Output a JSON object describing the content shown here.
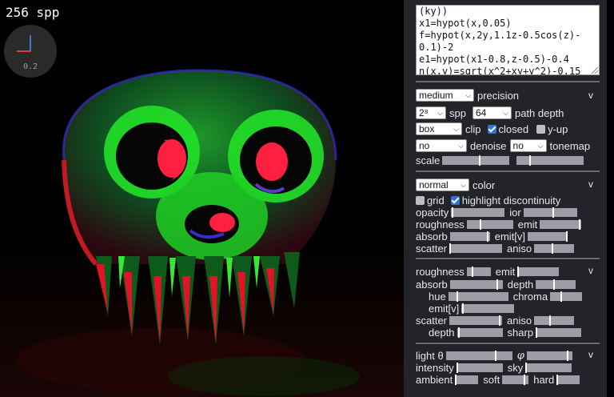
{
  "viewport": {
    "spp_readout": "256 spp",
    "axis_scale": "0.2"
  },
  "editor": {
    "lines": [
      "(ky))",
      "x1=hypot(x,0.05)",
      "f=hypot(x,2y,1.1z-0.5cos(z)-",
      "0.1)-2",
      "e1=hypot(x1-0.8,z-0.5)-0.4",
      "n(x,y)=sqrt(x^2+xy+y^2)-0.15"
    ]
  },
  "render": {
    "precision_value": "medium",
    "precision_label": "precision",
    "spp_value": "2⁸",
    "spp_label": "spp",
    "path_depth_value": "64",
    "path_depth_label": "path depth",
    "clip_value": "box",
    "clip_label": "clip",
    "closed_label": "closed",
    "closed_checked": true,
    "yup_label": "y-up",
    "yup_checked": false,
    "denoise_value": "no",
    "denoise_label": "denoise",
    "tonemap_value": "no",
    "tonemap_label": "tonemap",
    "scale_label": "scale",
    "scale_1": 0.55,
    "scale_2": 0.2,
    "collapse_icon": "v"
  },
  "material": {
    "mode_value": "normal",
    "mode_label": "color",
    "grid_label": "grid",
    "grid_checked": false,
    "highlight_label": "highlight discontinuity",
    "highlight_checked": true,
    "opacity_label": "opacity",
    "opacity": 0.02,
    "ior_label": "ior",
    "ior": 0.55,
    "roughness_label": "roughness",
    "roughness": 0.3,
    "emit_label": "emit",
    "emit": 0.95,
    "absorb_label": "absorb",
    "absorb": 0.95,
    "emitv_label": "emit[v]",
    "emitv": 0.98,
    "scatter_label": "scatter",
    "scatter": 0.02,
    "aniso_label": "aniso",
    "aniso": 0.45,
    "collapse_icon": "v"
  },
  "volume": {
    "roughness_label": "roughness",
    "roughness": 0.25,
    "emit_label": "emit",
    "emit": 0.02,
    "absorb_label": "absorb",
    "absorb": 0.9,
    "depth_label": "depth",
    "depth": 0.45,
    "hue_label": "hue",
    "hue": 0.15,
    "chroma_label": "chroma",
    "chroma": 0.35,
    "emitv_label": "emit[v]",
    "emitv": 0.02,
    "scatter_label": "scatter",
    "scatter": 0.95,
    "aniso_label": "aniso",
    "aniso": 0.4,
    "depth2_label": "depth",
    "depth2": 0.05,
    "sharp_label": "sharp",
    "sharp": 0.02,
    "collapse_icon": "v"
  },
  "light": {
    "theta_label": "light θ",
    "theta": 0.75,
    "phi_label": "φ",
    "phi": 0.9,
    "intensity_label": "intensity",
    "intensity": 0.02,
    "sky_label": "sky",
    "sky": 0.02,
    "ambient_label": "ambient",
    "ambient": 0.02,
    "soft_label": "soft",
    "soft": 0.85,
    "hard_label": "hard",
    "hard": 0.02,
    "collapse_icon": "v"
  }
}
